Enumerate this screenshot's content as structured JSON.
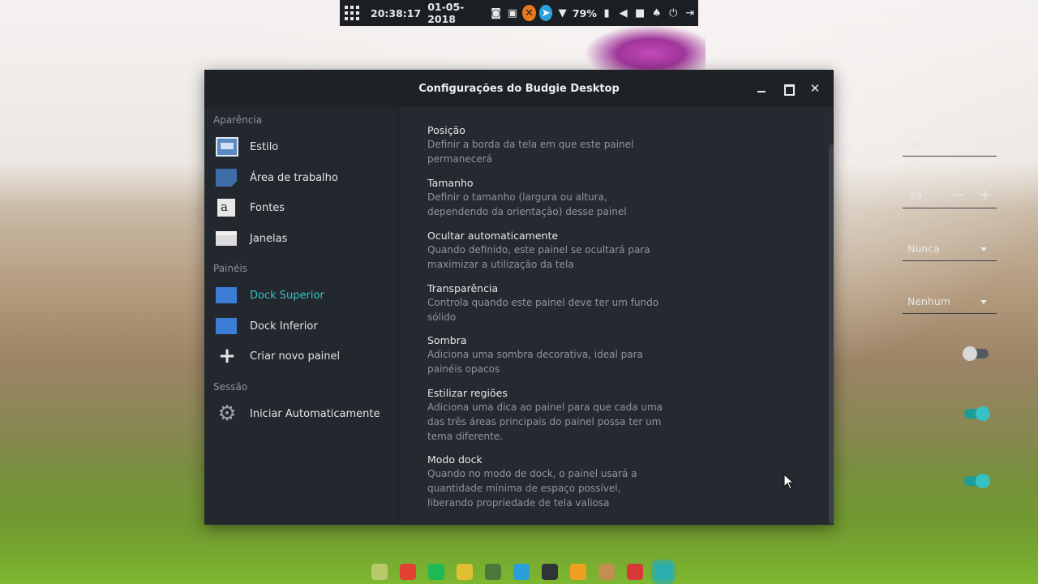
{
  "topbar": {
    "time": "20:38:17",
    "date": "01-05-2018",
    "battery": "79%",
    "icons": [
      "apps-grid-icon",
      "camera-icon",
      "screencast-icon",
      "xampp-icon",
      "telegram-icon",
      "wifi-icon",
      "battery-icon",
      "volume-icon",
      "folder-icon",
      "notifications-icon",
      "power-icon",
      "logout-icon"
    ]
  },
  "window": {
    "title": "Configurações do Budgie Desktop"
  },
  "sidebar": {
    "sections": [
      {
        "title": "Aparência",
        "items": [
          {
            "label": "Estilo",
            "icon": "style-icon"
          },
          {
            "label": "Área de trabalho",
            "icon": "desktop-icon"
          },
          {
            "label": "Fontes",
            "icon": "fonts-icon",
            "glyph": "a"
          },
          {
            "label": "Janelas",
            "icon": "windows-icon"
          }
        ]
      },
      {
        "title": "Painéis",
        "items": [
          {
            "label": "Dock Superior",
            "icon": "panel-icon",
            "active": true
          },
          {
            "label": "Dock Inferior",
            "icon": "panel-icon"
          },
          {
            "label": "Criar novo painel",
            "icon": "plus-icon"
          }
        ]
      },
      {
        "title": "Sessão",
        "items": [
          {
            "label": "Iniciar Automaticamente",
            "icon": "gear-icon"
          }
        ]
      }
    ]
  },
  "settings": {
    "position": {
      "title": "Posição",
      "desc": "Definir a borda da tela em que este painel permanecerá",
      "value": "Topo"
    },
    "size": {
      "title": "Tamanho",
      "desc": "Definir o tamanho (largura ou altura, dependendo da orientação) desse painel",
      "value": "39",
      "minus": "−",
      "plus": "+"
    },
    "autohide": {
      "title": "Ocultar automaticamente",
      "desc": "Quando definido, este painel se ocultará para maximizar a utilização da tela",
      "value": "Nunca"
    },
    "transparency": {
      "title": "Transparência",
      "desc": "Controla quando este painel deve ter um fundo sólido",
      "value": "Nenhum"
    },
    "shadow": {
      "title": "Sombra",
      "desc": "Adiciona uma sombra decorativa, ideal para painéis opacos",
      "enabled": false
    },
    "regions": {
      "title": "Estilizar regiões",
      "desc": "Adiciona uma dica ao painel para que cada uma das três áreas principais do painel possa ter um tema diferente.",
      "enabled": true
    },
    "dockmode": {
      "title": "Modo dock",
      "desc": "Quando no modo de dock, o painel usará a quantidade mínima de espaço possível, liberando propriedade de tela valiosa",
      "enabled": true
    }
  },
  "dock": {
    "apps": [
      {
        "name": "files",
        "color": "#b8c96a"
      },
      {
        "name": "chrome",
        "color": "#e34133"
      },
      {
        "name": "spotify",
        "color": "#1db954"
      },
      {
        "name": "cheese",
        "color": "#e0c030"
      },
      {
        "name": "pinta",
        "color": "#4a7a3a"
      },
      {
        "name": "headphones",
        "color": "#2a9fd8"
      },
      {
        "name": "terminal",
        "color": "#303438"
      },
      {
        "name": "vlc",
        "color": "#f0a020"
      },
      {
        "name": "uget",
        "color": "#c09050"
      },
      {
        "name": "screen-recorder",
        "color": "#d83838"
      },
      {
        "name": "budgie-settings",
        "color": "#2cadad",
        "active": true
      }
    ]
  }
}
